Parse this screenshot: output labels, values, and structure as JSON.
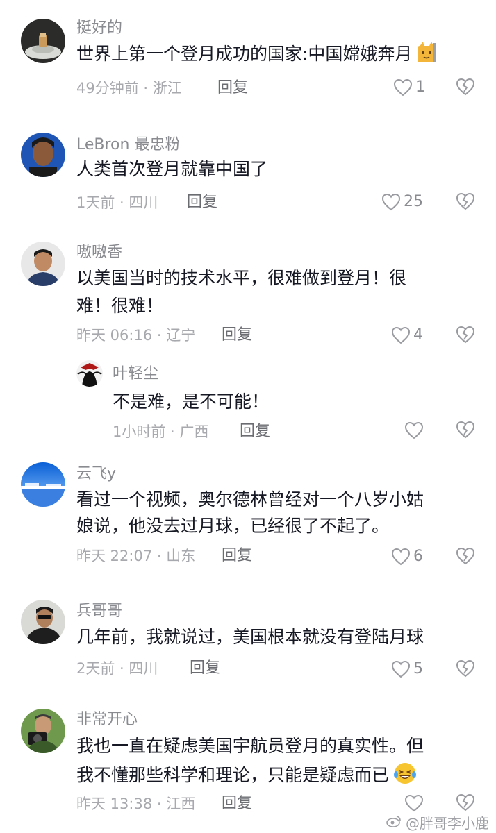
{
  "comments": [
    {
      "username": "挺好的",
      "text_lines": [
        "世界上第一个登月成功的国家:中国嫦娥奔月"
      ],
      "emoji": "cat-emoji",
      "meta": "49分钟前 · 浙江",
      "reply_label": "回复",
      "likes": "1"
    },
    {
      "username": "LeBron 最忠粉",
      "text_lines": [
        "人类首次登月就靠中国了"
      ],
      "meta": "1天前 · 四川",
      "reply_label": "回复",
      "likes": "25"
    },
    {
      "username": "嗷嗷香",
      "text_lines": [
        "以美国当时的技术水平，很难做到登月！很",
        "难！很难！"
      ],
      "meta": "昨天 06:16 · 辽宁",
      "reply_label": "回复",
      "likes": "4"
    },
    {
      "username": "叶轻尘",
      "text_lines": [
        "不是难，是不可能！"
      ],
      "meta": "1小时前 · 广西",
      "reply_label": "回复",
      "likes": ""
    },
    {
      "username": "云飞y",
      "text_lines": [
        "看过一个视频，奥尔德林曾经对一个八岁小姑",
        "娘说，他没去过月球，已经很了不起了。"
      ],
      "meta": "昨天 22:07 · 山东",
      "reply_label": "回复",
      "likes": "6"
    },
    {
      "username": "兵哥哥",
      "text_lines": [
        "几年前，我就说过，美国根本就没有登陆月球"
      ],
      "meta": "2天前 · 四川",
      "reply_label": "回复",
      "likes": "5"
    },
    {
      "username": "非常开心",
      "text_lines": [
        "我也一直在疑虑美国宇航员登月的真实性。但",
        "我不懂那些科学和理论，只能是疑虑而已"
      ],
      "emoji": "laughing-tears-emoji",
      "meta": "昨天 13:38 · 江西",
      "reply_label": "回复",
      "likes": ""
    }
  ],
  "watermark": "@胖哥李小鹿",
  "colors": {
    "text": "#161823",
    "username": "#8a8b91",
    "meta": "#a8a9ae",
    "icon": "#9a9ba0"
  }
}
